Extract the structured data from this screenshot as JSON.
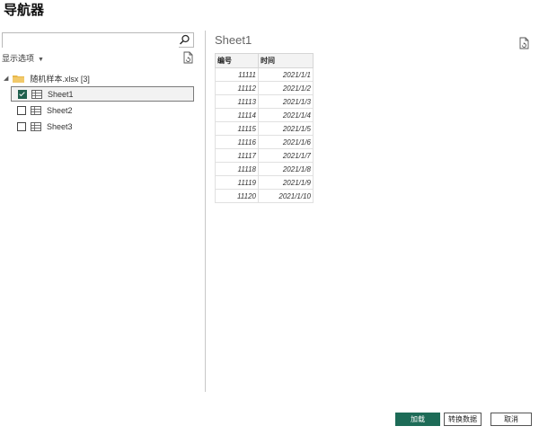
{
  "window": {
    "title": "导航器"
  },
  "search": {
    "value": "",
    "placeholder": ""
  },
  "display_options": {
    "label": "显示选项"
  },
  "tree": {
    "root": {
      "label": "随机样本.xlsx [3]",
      "expanded": true
    },
    "items": [
      {
        "label": "Sheet1",
        "checked": true,
        "selected": true
      },
      {
        "label": "Sheet2",
        "checked": false,
        "selected": false
      },
      {
        "label": "Sheet3",
        "checked": false,
        "selected": false
      }
    ]
  },
  "preview": {
    "title": "Sheet1",
    "columns": [
      "编号",
      "时间"
    ],
    "rows": [
      [
        "11111",
        "2021/1/1"
      ],
      [
        "11112",
        "2021/1/2"
      ],
      [
        "11113",
        "2021/1/3"
      ],
      [
        "11114",
        "2021/1/4"
      ],
      [
        "11115",
        "2021/1/5"
      ],
      [
        "11116",
        "2021/1/6"
      ],
      [
        "11117",
        "2021/1/7"
      ],
      [
        "11118",
        "2021/1/8"
      ],
      [
        "11119",
        "2021/1/9"
      ],
      [
        "11120",
        "2021/1/10"
      ]
    ]
  },
  "buttons": {
    "load": "加载",
    "transform": "转换数据",
    "cancel": "取消"
  },
  "colors": {
    "accent": "#1d6b57"
  }
}
